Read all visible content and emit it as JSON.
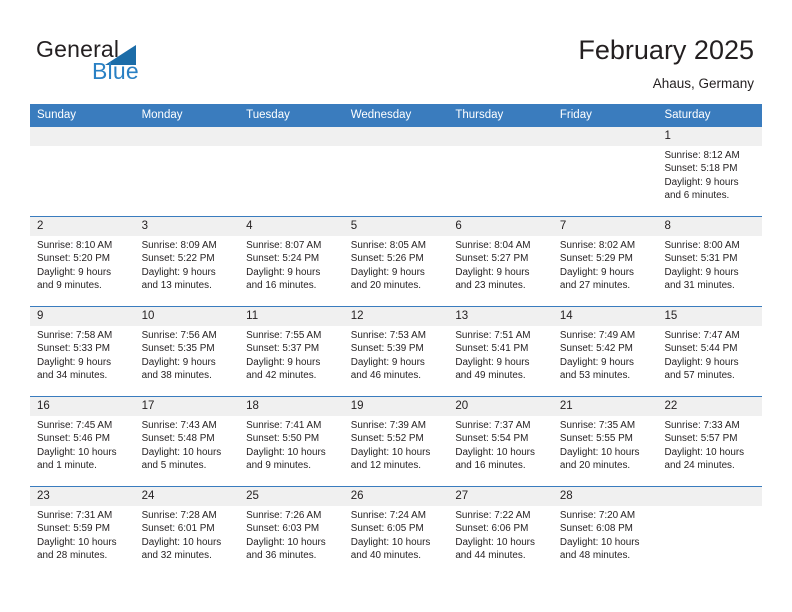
{
  "brand": {
    "name_part1": "General",
    "name_part2": "Blue",
    "accent_color": "#2980c4",
    "logo_triangle_color": "#1b6ca8"
  },
  "header": {
    "month_title": "February 2025",
    "location": "Ahaus, Germany"
  },
  "calendar": {
    "header_color": "#3a7cbe",
    "daynum_band_color": "#f0f0f0",
    "weekdays": [
      "Sunday",
      "Monday",
      "Tuesday",
      "Wednesday",
      "Thursday",
      "Friday",
      "Saturday"
    ],
    "weeks": [
      [
        {
          "day": "",
          "sunrise": "",
          "sunset": "",
          "daylight_line1": "",
          "daylight_line2": ""
        },
        {
          "day": "",
          "sunrise": "",
          "sunset": "",
          "daylight_line1": "",
          "daylight_line2": ""
        },
        {
          "day": "",
          "sunrise": "",
          "sunset": "",
          "daylight_line1": "",
          "daylight_line2": ""
        },
        {
          "day": "",
          "sunrise": "",
          "sunset": "",
          "daylight_line1": "",
          "daylight_line2": ""
        },
        {
          "day": "",
          "sunrise": "",
          "sunset": "",
          "daylight_line1": "",
          "daylight_line2": ""
        },
        {
          "day": "",
          "sunrise": "",
          "sunset": "",
          "daylight_line1": "",
          "daylight_line2": ""
        },
        {
          "day": "1",
          "sunrise": "Sunrise: 8:12 AM",
          "sunset": "Sunset: 5:18 PM",
          "daylight_line1": "Daylight: 9 hours",
          "daylight_line2": "and 6 minutes."
        }
      ],
      [
        {
          "day": "2",
          "sunrise": "Sunrise: 8:10 AM",
          "sunset": "Sunset: 5:20 PM",
          "daylight_line1": "Daylight: 9 hours",
          "daylight_line2": "and 9 minutes."
        },
        {
          "day": "3",
          "sunrise": "Sunrise: 8:09 AM",
          "sunset": "Sunset: 5:22 PM",
          "daylight_line1": "Daylight: 9 hours",
          "daylight_line2": "and 13 minutes."
        },
        {
          "day": "4",
          "sunrise": "Sunrise: 8:07 AM",
          "sunset": "Sunset: 5:24 PM",
          "daylight_line1": "Daylight: 9 hours",
          "daylight_line2": "and 16 minutes."
        },
        {
          "day": "5",
          "sunrise": "Sunrise: 8:05 AM",
          "sunset": "Sunset: 5:26 PM",
          "daylight_line1": "Daylight: 9 hours",
          "daylight_line2": "and 20 minutes."
        },
        {
          "day": "6",
          "sunrise": "Sunrise: 8:04 AM",
          "sunset": "Sunset: 5:27 PM",
          "daylight_line1": "Daylight: 9 hours",
          "daylight_line2": "and 23 minutes."
        },
        {
          "day": "7",
          "sunrise": "Sunrise: 8:02 AM",
          "sunset": "Sunset: 5:29 PM",
          "daylight_line1": "Daylight: 9 hours",
          "daylight_line2": "and 27 minutes."
        },
        {
          "day": "8",
          "sunrise": "Sunrise: 8:00 AM",
          "sunset": "Sunset: 5:31 PM",
          "daylight_line1": "Daylight: 9 hours",
          "daylight_line2": "and 31 minutes."
        }
      ],
      [
        {
          "day": "9",
          "sunrise": "Sunrise: 7:58 AM",
          "sunset": "Sunset: 5:33 PM",
          "daylight_line1": "Daylight: 9 hours",
          "daylight_line2": "and 34 minutes."
        },
        {
          "day": "10",
          "sunrise": "Sunrise: 7:56 AM",
          "sunset": "Sunset: 5:35 PM",
          "daylight_line1": "Daylight: 9 hours",
          "daylight_line2": "and 38 minutes."
        },
        {
          "day": "11",
          "sunrise": "Sunrise: 7:55 AM",
          "sunset": "Sunset: 5:37 PM",
          "daylight_line1": "Daylight: 9 hours",
          "daylight_line2": "and 42 minutes."
        },
        {
          "day": "12",
          "sunrise": "Sunrise: 7:53 AM",
          "sunset": "Sunset: 5:39 PM",
          "daylight_line1": "Daylight: 9 hours",
          "daylight_line2": "and 46 minutes."
        },
        {
          "day": "13",
          "sunrise": "Sunrise: 7:51 AM",
          "sunset": "Sunset: 5:41 PM",
          "daylight_line1": "Daylight: 9 hours",
          "daylight_line2": "and 49 minutes."
        },
        {
          "day": "14",
          "sunrise": "Sunrise: 7:49 AM",
          "sunset": "Sunset: 5:42 PM",
          "daylight_line1": "Daylight: 9 hours",
          "daylight_line2": "and 53 minutes."
        },
        {
          "day": "15",
          "sunrise": "Sunrise: 7:47 AM",
          "sunset": "Sunset: 5:44 PM",
          "daylight_line1": "Daylight: 9 hours",
          "daylight_line2": "and 57 minutes."
        }
      ],
      [
        {
          "day": "16",
          "sunrise": "Sunrise: 7:45 AM",
          "sunset": "Sunset: 5:46 PM",
          "daylight_line1": "Daylight: 10 hours",
          "daylight_line2": "and 1 minute."
        },
        {
          "day": "17",
          "sunrise": "Sunrise: 7:43 AM",
          "sunset": "Sunset: 5:48 PM",
          "daylight_line1": "Daylight: 10 hours",
          "daylight_line2": "and 5 minutes."
        },
        {
          "day": "18",
          "sunrise": "Sunrise: 7:41 AM",
          "sunset": "Sunset: 5:50 PM",
          "daylight_line1": "Daylight: 10 hours",
          "daylight_line2": "and 9 minutes."
        },
        {
          "day": "19",
          "sunrise": "Sunrise: 7:39 AM",
          "sunset": "Sunset: 5:52 PM",
          "daylight_line1": "Daylight: 10 hours",
          "daylight_line2": "and 12 minutes."
        },
        {
          "day": "20",
          "sunrise": "Sunrise: 7:37 AM",
          "sunset": "Sunset: 5:54 PM",
          "daylight_line1": "Daylight: 10 hours",
          "daylight_line2": "and 16 minutes."
        },
        {
          "day": "21",
          "sunrise": "Sunrise: 7:35 AM",
          "sunset": "Sunset: 5:55 PM",
          "daylight_line1": "Daylight: 10 hours",
          "daylight_line2": "and 20 minutes."
        },
        {
          "day": "22",
          "sunrise": "Sunrise: 7:33 AM",
          "sunset": "Sunset: 5:57 PM",
          "daylight_line1": "Daylight: 10 hours",
          "daylight_line2": "and 24 minutes."
        }
      ],
      [
        {
          "day": "23",
          "sunrise": "Sunrise: 7:31 AM",
          "sunset": "Sunset: 5:59 PM",
          "daylight_line1": "Daylight: 10 hours",
          "daylight_line2": "and 28 minutes."
        },
        {
          "day": "24",
          "sunrise": "Sunrise: 7:28 AM",
          "sunset": "Sunset: 6:01 PM",
          "daylight_line1": "Daylight: 10 hours",
          "daylight_line2": "and 32 minutes."
        },
        {
          "day": "25",
          "sunrise": "Sunrise: 7:26 AM",
          "sunset": "Sunset: 6:03 PM",
          "daylight_line1": "Daylight: 10 hours",
          "daylight_line2": "and 36 minutes."
        },
        {
          "day": "26",
          "sunrise": "Sunrise: 7:24 AM",
          "sunset": "Sunset: 6:05 PM",
          "daylight_line1": "Daylight: 10 hours",
          "daylight_line2": "and 40 minutes."
        },
        {
          "day": "27",
          "sunrise": "Sunrise: 7:22 AM",
          "sunset": "Sunset: 6:06 PM",
          "daylight_line1": "Daylight: 10 hours",
          "daylight_line2": "and 44 minutes."
        },
        {
          "day": "28",
          "sunrise": "Sunrise: 7:20 AM",
          "sunset": "Sunset: 6:08 PM",
          "daylight_line1": "Daylight: 10 hours",
          "daylight_line2": "and 48 minutes."
        },
        {
          "day": "",
          "sunrise": "",
          "sunset": "",
          "daylight_line1": "",
          "daylight_line2": ""
        }
      ]
    ]
  }
}
